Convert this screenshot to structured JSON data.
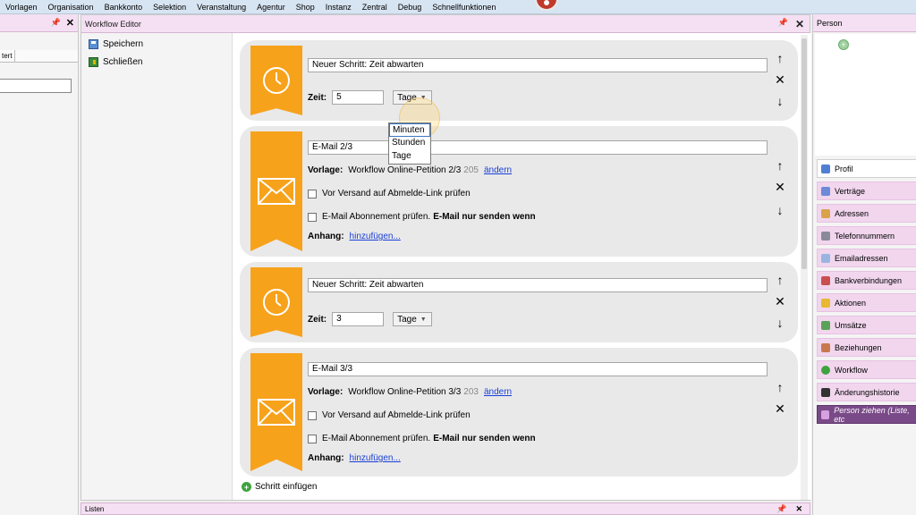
{
  "menu": [
    "Vorlagen",
    "Organisation",
    "Bankkonto",
    "Selektion",
    "Veranstaltung",
    "Agentur",
    "Shop",
    "Instanz",
    "Zentral",
    "Debug",
    "Schnellfunktionen"
  ],
  "left_panel": {
    "tab_label": "tert",
    "pin": "📌",
    "close": "✕"
  },
  "workflow_editor": {
    "title": "Workflow Editor",
    "pin": "📌",
    "close": "✕",
    "actions": {
      "save": "Speichern",
      "close": "Schließen"
    },
    "steps": [
      {
        "type": "wait",
        "name": "Neuer Schritt: Zeit abwarten",
        "zeit_label": "Zeit:",
        "value": "5",
        "unit": "Tage"
      },
      {
        "type": "email",
        "name": "E-Mail 2/3",
        "vorlage_label": "Vorlage:",
        "vorlage_name": "Workflow Online-Petition 2/3",
        "vorlage_id": "205",
        "change_link": "ändern",
        "check1": "Vor Versand auf Abmelde-Link prüfen",
        "check2": "E-Mail Abonnement prüfen.",
        "check2_bold": "E-Mail nur senden wenn",
        "anhang_label": "Anhang:",
        "anhang_link": "hinzufügen..."
      },
      {
        "type": "wait",
        "name": "Neuer Schritt: Zeit abwarten",
        "zeit_label": "Zeit:",
        "value": "3",
        "unit": "Tage"
      },
      {
        "type": "email",
        "name": "E-Mail 3/3",
        "vorlage_label": "Vorlage:",
        "vorlage_name": "Workflow Online-Petition 3/3",
        "vorlage_id": "203",
        "change_link": "ändern",
        "check1": "Vor Versand auf Abmelde-Link prüfen",
        "check2": "E-Mail Abonnement prüfen.",
        "check2_bold": "E-Mail nur senden wenn",
        "anhang_label": "Anhang:",
        "anhang_link": "hinzufügen..."
      }
    ],
    "dropdown_options": [
      "Minuten",
      "Stunden",
      "Tage"
    ],
    "insert_step": "Schritt einfügen",
    "arrows": {
      "up": "↑",
      "remove": "✕",
      "down": "↓"
    }
  },
  "listen": {
    "title": "Listen",
    "pin": "📌",
    "close": "✕"
  },
  "person": {
    "title": "Person",
    "items": [
      "Profil",
      "Verträge",
      "Adressen",
      "Telefonnummern",
      "Emailadressen",
      "Bankverbindungen",
      "Aktionen",
      "Umsätze",
      "Beziehungen",
      "Workflow",
      "Änderungshistorie",
      "Person ziehen (Liste, etc"
    ]
  },
  "colors": {
    "accent_orange": "#f7a21b",
    "panel_pink": "#f4e0f2",
    "link_blue": "#1a3fd6"
  }
}
